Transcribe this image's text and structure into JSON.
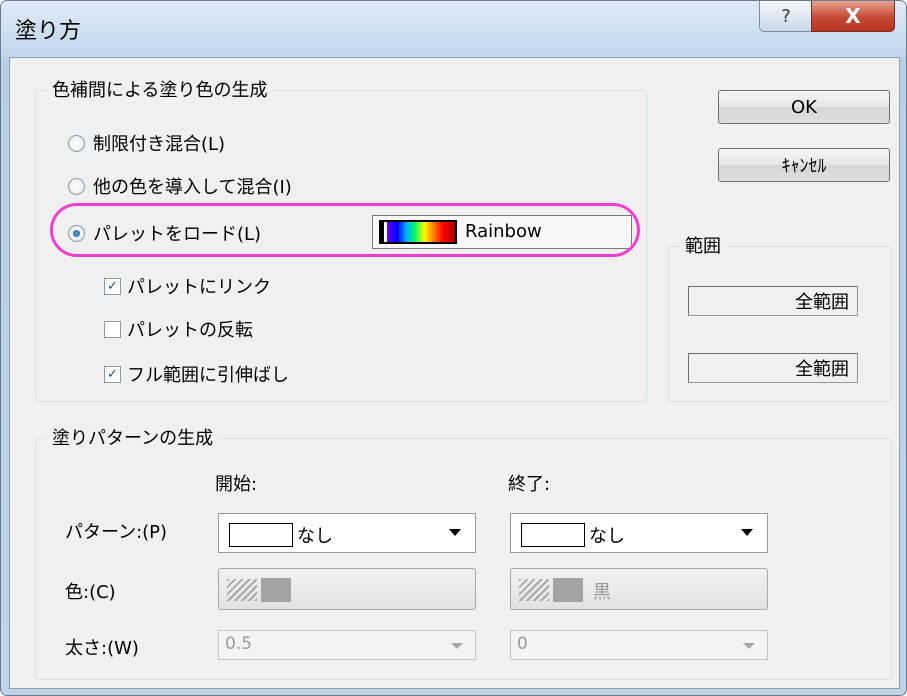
{
  "window": {
    "title": "塗り方",
    "help_glyph": "?",
    "close_glyph": "X"
  },
  "color_group": {
    "legend": "色補間による塗り色の生成",
    "options": [
      {
        "label": "制限付き混合(L)",
        "checked": false
      },
      {
        "label": "他の色を導入して混合(I)",
        "checked": false
      },
      {
        "label": "パレットをロード(L)",
        "checked": true
      }
    ],
    "palette_name": "Rainbow",
    "checkboxes": [
      {
        "label": "パレットにリンク",
        "checked": true
      },
      {
        "label": "パレットの反転",
        "checked": false
      },
      {
        "label": "フル範囲に引伸ばし",
        "checked": true
      }
    ]
  },
  "buttons": {
    "ok": "OK",
    "cancel": "ｷｬﾝｾﾙ"
  },
  "range_group": {
    "legend": "範囲",
    "from": "全範囲",
    "to": "全範囲"
  },
  "pattern_group": {
    "legend": "塗りパターンの生成",
    "start_header": "開始:",
    "end_header": "終了:",
    "pattern_label": "パターン:(P)",
    "color_label": "色:(C)",
    "width_label": "太さ:(W)",
    "start_pattern": "なし",
    "end_pattern": "なし",
    "start_color": "",
    "end_color": "黒",
    "start_width": "0.5",
    "end_width": "0"
  },
  "colors": {
    "highlight": "#ee3fd0",
    "close_button": "#c44a35"
  }
}
